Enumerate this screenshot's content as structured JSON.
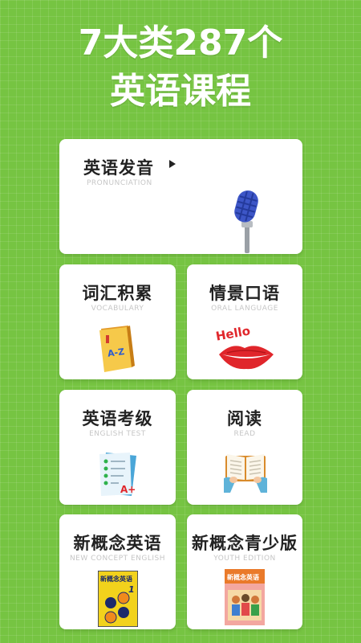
{
  "headline": {
    "line1": "7大类287个",
    "line2": "英语课程"
  },
  "cards": [
    {
      "title": "英语发音",
      "subtitle": "PRONUNCIATION",
      "icon": "microphone-icon"
    },
    {
      "title": "词汇积累",
      "subtitle": "VOCABULARY",
      "icon": "dictionary-book-icon"
    },
    {
      "title": "情景口语",
      "subtitle": "ORAL LANGUAGE",
      "icon": "hello-lips-icon",
      "art_text": "Hello"
    },
    {
      "title": "英语考级",
      "subtitle": "ENGLISH TEST",
      "icon": "test-paper-icon",
      "art_text": "A+"
    },
    {
      "title": "阅读",
      "subtitle": "READ",
      "icon": "open-book-icon"
    },
    {
      "title": "新概念英语",
      "subtitle": "NEW CONCEPT ENGLISH",
      "icon": "new-concept-book-icon",
      "art_text": "新概念英语",
      "art_number": "1"
    },
    {
      "title": "新概念青少版",
      "subtitle": "YOUTH EDITION",
      "icon": "youth-edition-book-icon",
      "art_text": "新概念英语"
    }
  ],
  "colors": {
    "background": "#76c442",
    "card": "#ffffff",
    "title": "#222222",
    "subtitle": "#c6c6c6"
  }
}
